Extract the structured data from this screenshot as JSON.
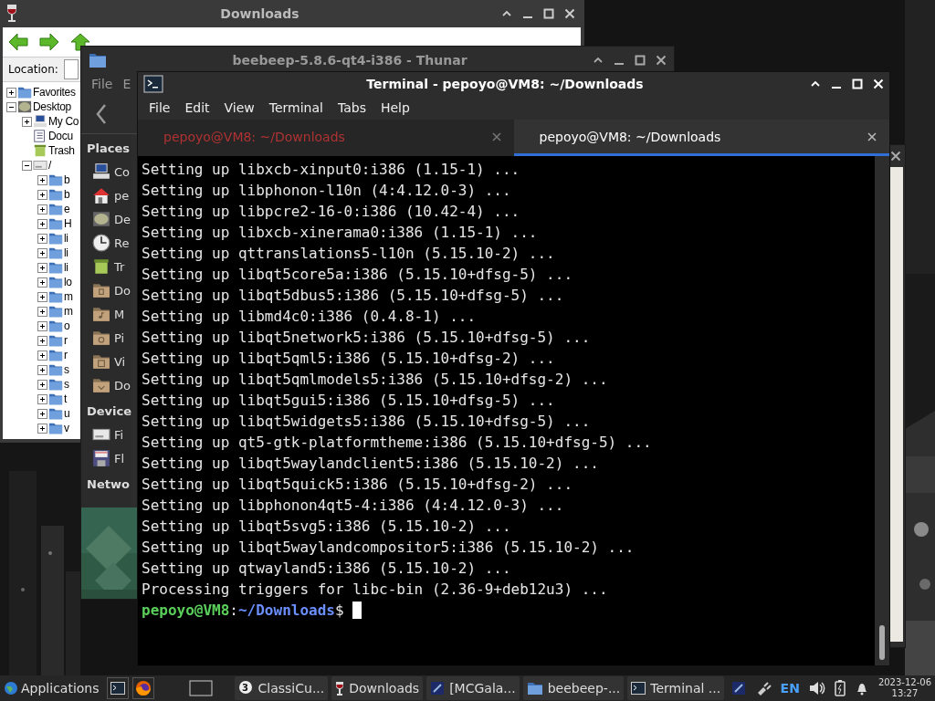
{
  "explorer_window": {
    "title": "Downloads",
    "location_label": "Location:",
    "tree": [
      {
        "label": "Favorites",
        "kind": "folder",
        "expanded": false
      },
      {
        "label": "Desktop",
        "kind": "desktop",
        "expanded": true,
        "children": [
          {
            "label": "My Co",
            "kind": "computer",
            "expanded": false
          },
          {
            "label": "Docu",
            "kind": "document"
          },
          {
            "label": "Trash",
            "kind": "trash"
          },
          {
            "label": "/",
            "kind": "drive",
            "expanded": true,
            "children": [
              {
                "label": "b",
                "kind": "folder",
                "expanded": false
              },
              {
                "label": "b",
                "kind": "folder",
                "expanded": false
              },
              {
                "label": "e",
                "kind": "folder",
                "expanded": false
              },
              {
                "label": "H",
                "kind": "folder",
                "expanded": false
              },
              {
                "label": "li",
                "kind": "folder",
                "expanded": false
              },
              {
                "label": "li",
                "kind": "folder",
                "expanded": false
              },
              {
                "label": "li",
                "kind": "folder",
                "expanded": false
              },
              {
                "label": "lo",
                "kind": "folder",
                "expanded": false
              },
              {
                "label": "m",
                "kind": "folder",
                "expanded": false
              },
              {
                "label": "m",
                "kind": "folder",
                "expanded": false
              },
              {
                "label": "o",
                "kind": "folder",
                "expanded": false
              },
              {
                "label": "r",
                "kind": "folder",
                "expanded": false
              },
              {
                "label": "r",
                "kind": "folder",
                "expanded": false
              },
              {
                "label": "s",
                "kind": "folder",
                "expanded": false
              },
              {
                "label": "s",
                "kind": "folder",
                "expanded": false
              },
              {
                "label": "t",
                "kind": "folder",
                "expanded": false
              },
              {
                "label": "u",
                "kind": "folder",
                "expanded": false
              },
              {
                "label": "v",
                "kind": "folder",
                "expanded": false
              }
            ]
          }
        ]
      }
    ]
  },
  "thunar_window": {
    "title": "beebeep-5.8.6-qt4-i386 - Thunar",
    "menu": [
      "File",
      "E"
    ],
    "sidebar": [
      {
        "heading": "Places",
        "items": [
          {
            "label": "Co",
            "kind": "computer"
          },
          {
            "label": "pe",
            "kind": "home"
          },
          {
            "label": "De",
            "kind": "desktop"
          },
          {
            "label": "Re",
            "kind": "recent"
          },
          {
            "label": "Tr",
            "kind": "trash"
          },
          {
            "label": "Do",
            "kind": "documents"
          },
          {
            "label": "M",
            "kind": "music"
          },
          {
            "label": "Pi",
            "kind": "pictures"
          },
          {
            "label": "Vi",
            "kind": "videos"
          },
          {
            "label": "Do",
            "kind": "downloads"
          }
        ]
      },
      {
        "heading": "Device",
        "items": [
          {
            "label": "Fi",
            "kind": "drive"
          },
          {
            "label": "Fl",
            "kind": "floppy"
          }
        ]
      },
      {
        "heading": "Netwo"
      }
    ],
    "preview": {
      "kind": "picture"
    }
  },
  "terminal_window": {
    "title": "Terminal - pepoyo@VM8: ~/Downloads",
    "menu": [
      "File",
      "Edit",
      "View",
      "Terminal",
      "Tabs",
      "Help"
    ],
    "tabs": [
      {
        "label": "pepoyo@VM8: ~/Downloads",
        "selected": false
      },
      {
        "label": "pepoyo@VM8: ~/Downloads",
        "selected": true
      }
    ],
    "lines": [
      "Setting up libxcb-xinput0:i386 (1.15-1) ...",
      "Setting up libphonon-l10n (4:4.12.0-3) ...",
      "Setting up libpcre2-16-0:i386 (10.42-4) ...",
      "Setting up libxcb-xinerama0:i386 (1.15-1) ...",
      "Setting up qttranslations5-l10n (5.15.10-2) ...",
      "Setting up libqt5core5a:i386 (5.15.10+dfsg-5) ...",
      "Setting up libqt5dbus5:i386 (5.15.10+dfsg-5) ...",
      "Setting up libmd4c0:i386 (0.4.8-1) ...",
      "Setting up libqt5network5:i386 (5.15.10+dfsg-5) ...",
      "Setting up libqt5qml5:i386 (5.15.10+dfsg-2) ...",
      "Setting up libqt5qmlmodels5:i386 (5.15.10+dfsg-2) ...",
      "Setting up libqt5gui5:i386 (5.15.10+dfsg-5) ...",
      "Setting up libqt5widgets5:i386 (5.15.10+dfsg-5) ...",
      "Setting up qt5-gtk-platformtheme:i386 (5.15.10+dfsg-5) ...",
      "Setting up libqt5waylandclient5:i386 (5.15.10-2) ...",
      "Setting up libqt5quick5:i386 (5.15.10+dfsg-2) ...",
      "Setting up libphonon4qt5-4:i386 (4:4.12.0-3) ...",
      "Setting up libqt5svg5:i386 (5.15.10-2) ...",
      "Setting up libqt5waylandcompositor5:i386 (5.15.10-2) ...",
      "Setting up qtwayland5:i386 (5.15.10-2) ...",
      "Processing triggers for libc-bin (2.36-9+deb12u3) ..."
    ],
    "prompt": {
      "user_host": "pepoyo@VM8",
      "separator": ":",
      "path": "~/Downloads",
      "symbol": "$"
    }
  },
  "taskbar": {
    "applications": "Applications",
    "tasks": [
      {
        "label": "ClassiCu...",
        "kind": "app",
        "badge": "3"
      },
      {
        "label": "Downloads",
        "kind": "wine"
      },
      {
        "label": "[MCGala...",
        "kind": "app"
      },
      {
        "label": "beebeep-...",
        "kind": "folder"
      },
      {
        "label": "Terminal ...",
        "kind": "terminal"
      }
    ],
    "language": "EN",
    "date": "2023-12-06",
    "time": "13:27"
  }
}
